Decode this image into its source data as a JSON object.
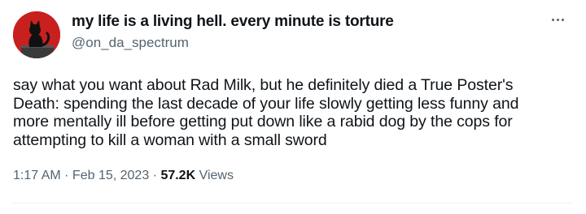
{
  "author": {
    "display_name": "my life is a living hell. every minute is torture",
    "handle": "@on_da_spectrum",
    "avatar_icon": "black-cat-avatar-icon",
    "avatar_color": "#c8201e"
  },
  "menu": {
    "icon": "more-options-icon"
  },
  "tweet": {
    "lines": [
      "say what you want about Rad Milk, but he definitely died a True Poster's",
      "Death: spending the last decade of your life slowly getting less funny and",
      "more mentally ill before getting put down like a rabid dog by the cops for",
      "attempting to kill a woman with a small sword"
    ]
  },
  "meta": {
    "time": "1:17 AM",
    "separator": " · ",
    "date": "Feb 15, 2023",
    "views_count": "57.2K",
    "views_label": " Views"
  },
  "colors": {
    "text": "#0f1419",
    "secondary": "#536471",
    "divider": "#eff3f4"
  }
}
